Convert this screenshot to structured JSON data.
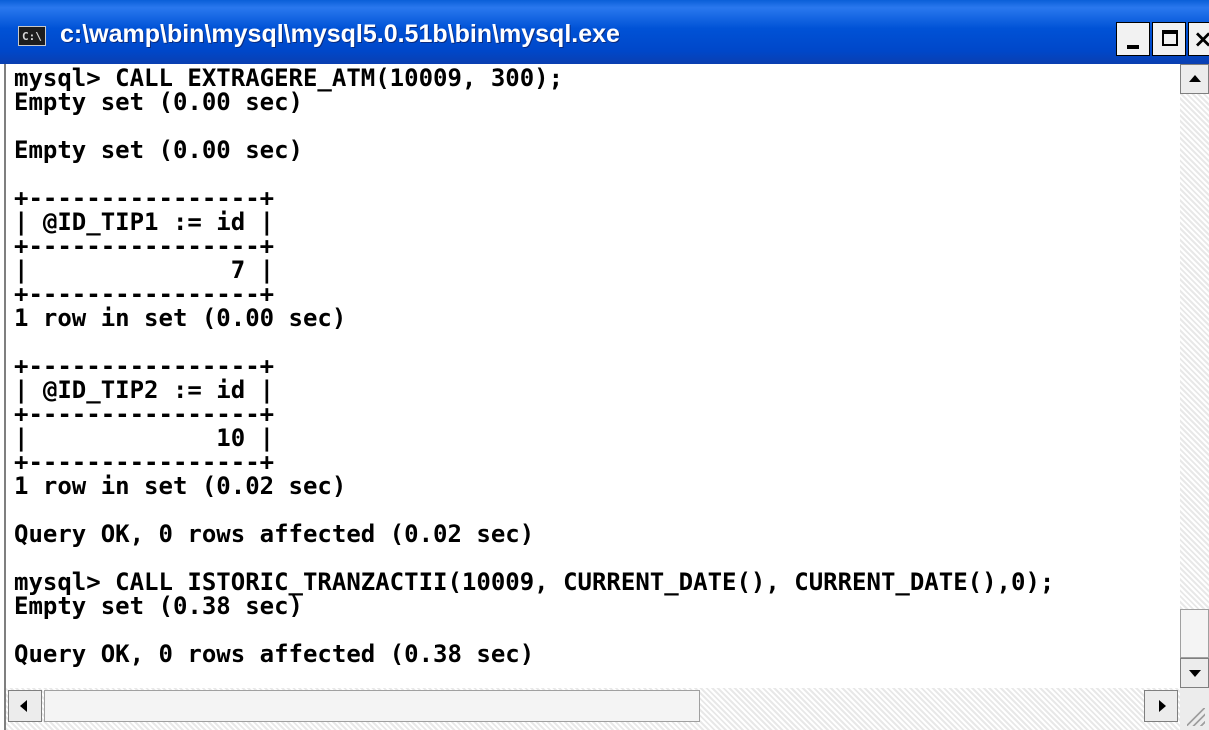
{
  "window": {
    "title": "c:\\wamp\\bin\\mysql\\mysql5.0.51b\\bin\\mysql.exe",
    "icon": "cmd-icon",
    "icon_text": "C:\\",
    "controls": {
      "minimize_icon": "minimize-icon",
      "maximize_icon": "maximize-icon",
      "close_label": "×"
    }
  },
  "console": {
    "lines": [
      "mysql> CALL EXTRAGERE_ATM(10009, 300);",
      "Empty set (0.00 sec)",
      "",
      "Empty set (0.00 sec)",
      "",
      "+----------------+",
      "| @ID_TIP1 := id |",
      "+----------------+",
      "|              7 |",
      "+----------------+",
      "1 row in set (0.00 sec)",
      "",
      "+----------------+",
      "| @ID_TIP2 := id |",
      "+----------------+",
      "|             10 |",
      "+----------------+",
      "1 row in set (0.02 sec)",
      "",
      "Query OK, 0 rows affected (0.02 sec)",
      "",
      "mysql> CALL ISTORIC_TRANZACTII(10009, CURRENT_DATE(), CURRENT_DATE(),0);",
      "Empty set (0.38 sec)",
      "",
      "Query OK, 0 rows affected (0.38 sec)"
    ]
  },
  "scrollbars": {
    "vertical_position": 0.93,
    "horizontal_position": 0.0
  }
}
